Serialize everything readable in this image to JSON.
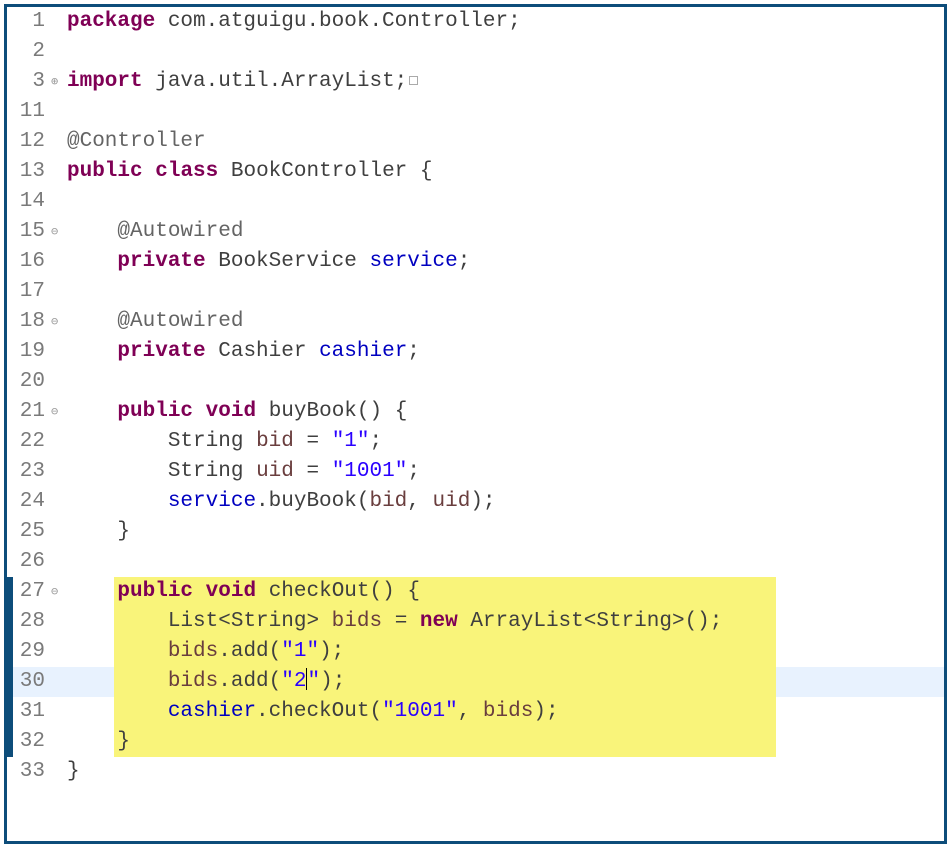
{
  "lines": [
    {
      "num": "1",
      "annot": "",
      "tokens": [
        [
          "kw",
          "package"
        ],
        [
          "txt",
          " com.atguigu.book.Controller;"
        ]
      ]
    },
    {
      "num": "2",
      "annot": "",
      "tokens": []
    },
    {
      "num": "3",
      "annot": "⊕",
      "tokens": [
        [
          "kw",
          "import"
        ],
        [
          "txt",
          " java.util.ArrayList;"
        ]
      ],
      "fold": true
    },
    {
      "num": "11",
      "annot": "",
      "tokens": []
    },
    {
      "num": "12",
      "annot": "",
      "tokens": [
        [
          "annot",
          "@Controller"
        ]
      ]
    },
    {
      "num": "13",
      "annot": "",
      "tokens": [
        [
          "kw",
          "public"
        ],
        [
          "txt",
          " "
        ],
        [
          "kw",
          "class"
        ],
        [
          "txt",
          " "
        ],
        [
          "type",
          "BookController"
        ],
        [
          "txt",
          " {"
        ]
      ]
    },
    {
      "num": "14",
      "annot": "",
      "tokens": []
    },
    {
      "num": "15",
      "annot": "⊖",
      "tokens": [
        [
          "txt",
          "    "
        ],
        [
          "annot",
          "@Autowired"
        ]
      ]
    },
    {
      "num": "16",
      "annot": "",
      "tokens": [
        [
          "txt",
          "    "
        ],
        [
          "kw",
          "private"
        ],
        [
          "txt",
          " "
        ],
        [
          "type",
          "BookService"
        ],
        [
          "txt",
          " "
        ],
        [
          "field",
          "service"
        ],
        [
          "txt",
          ";"
        ]
      ]
    },
    {
      "num": "17",
      "annot": "",
      "tokens": []
    },
    {
      "num": "18",
      "annot": "⊖",
      "tokens": [
        [
          "txt",
          "    "
        ],
        [
          "annot",
          "@Autowired"
        ]
      ]
    },
    {
      "num": "19",
      "annot": "",
      "tokens": [
        [
          "txt",
          "    "
        ],
        [
          "kw",
          "private"
        ],
        [
          "txt",
          " "
        ],
        [
          "type",
          "Cashier"
        ],
        [
          "txt",
          " "
        ],
        [
          "field",
          "cashier"
        ],
        [
          "txt",
          ";"
        ]
      ]
    },
    {
      "num": "20",
      "annot": "",
      "tokens": []
    },
    {
      "num": "21",
      "annot": "⊖",
      "tokens": [
        [
          "txt",
          "    "
        ],
        [
          "kw",
          "public"
        ],
        [
          "txt",
          " "
        ],
        [
          "kw",
          "void"
        ],
        [
          "txt",
          " "
        ],
        [
          "method",
          "buyBook"
        ],
        [
          "txt",
          "() {"
        ]
      ]
    },
    {
      "num": "22",
      "annot": "",
      "tokens": [
        [
          "txt",
          "        "
        ],
        [
          "type",
          "String"
        ],
        [
          "txt",
          " "
        ],
        [
          "var",
          "bid"
        ],
        [
          "txt",
          " = "
        ],
        [
          "str",
          "\"1\""
        ],
        [
          "txt",
          ";"
        ]
      ]
    },
    {
      "num": "23",
      "annot": "",
      "tokens": [
        [
          "txt",
          "        "
        ],
        [
          "type",
          "String"
        ],
        [
          "txt",
          " "
        ],
        [
          "var",
          "uid"
        ],
        [
          "txt",
          " = "
        ],
        [
          "str",
          "\"1001\""
        ],
        [
          "txt",
          ";"
        ]
      ]
    },
    {
      "num": "24",
      "annot": "",
      "tokens": [
        [
          "txt",
          "        "
        ],
        [
          "field",
          "service"
        ],
        [
          "txt",
          ".buyBook("
        ],
        [
          "var",
          "bid"
        ],
        [
          "txt",
          ", "
        ],
        [
          "var",
          "uid"
        ],
        [
          "txt",
          ");"
        ]
      ]
    },
    {
      "num": "25",
      "annot": "",
      "tokens": [
        [
          "txt",
          "    }"
        ]
      ]
    },
    {
      "num": "26",
      "annot": "",
      "tokens": []
    },
    {
      "num": "27",
      "annot": "⊖",
      "hlYellow": true,
      "stripe": true,
      "tokens": [
        [
          "txt",
          "    "
        ],
        [
          "kw",
          "public"
        ],
        [
          "txt",
          " "
        ],
        [
          "kw",
          "void"
        ],
        [
          "txt",
          " "
        ],
        [
          "method",
          "checkOut"
        ],
        [
          "txt",
          "() {"
        ]
      ]
    },
    {
      "num": "28",
      "annot": "",
      "hlYellow": true,
      "stripe": true,
      "tokens": [
        [
          "txt",
          "        "
        ],
        [
          "type",
          "List<String>"
        ],
        [
          "txt",
          " "
        ],
        [
          "var",
          "bids"
        ],
        [
          "txt",
          " = "
        ],
        [
          "kw",
          "new"
        ],
        [
          "txt",
          " "
        ],
        [
          "type",
          "ArrayList<String>"
        ],
        [
          "txt",
          "();"
        ]
      ]
    },
    {
      "num": "29",
      "annot": "",
      "hlYellow": true,
      "stripe": true,
      "tokens": [
        [
          "txt",
          "        "
        ],
        [
          "var",
          "bids"
        ],
        [
          "txt",
          ".add("
        ],
        [
          "str",
          "\"1\""
        ],
        [
          "txt",
          ");"
        ]
      ]
    },
    {
      "num": "30",
      "annot": "",
      "hlBlue": true,
      "hlYellow": true,
      "stripe": true,
      "caretAfter": 4,
      "tokens": [
        [
          "txt",
          "        "
        ],
        [
          "var",
          "bids"
        ],
        [
          "txt",
          ".add("
        ],
        [
          "str",
          "\"2"
        ],
        [
          "str",
          "\""
        ],
        [
          "txt",
          ");"
        ]
      ]
    },
    {
      "num": "31",
      "annot": "",
      "hlYellow": true,
      "stripe": true,
      "tokens": [
        [
          "txt",
          "        "
        ],
        [
          "field",
          "cashier"
        ],
        [
          "txt",
          ".checkOut("
        ],
        [
          "str",
          "\"1001\""
        ],
        [
          "txt",
          ", "
        ],
        [
          "var",
          "bids"
        ],
        [
          "txt",
          ");"
        ]
      ]
    },
    {
      "num": "32",
      "annot": "",
      "hlYellow": true,
      "stripe": true,
      "tokens": [
        [
          "txt",
          "    }"
        ]
      ]
    },
    {
      "num": "33",
      "annot": "",
      "tokens": [
        [
          "txt",
          "}"
        ]
      ]
    }
  ],
  "highlight": {
    "startRow": 19,
    "endRow": 25
  },
  "colors": {
    "keyword": "#7f0055",
    "annotation": "#646464",
    "field": "#0000c0",
    "string": "#2a00ff",
    "localvar": "#6a3e3e",
    "border": "#0d4d7a",
    "yellowHL": "#f9f47a",
    "blueHL": "#e8f2fe"
  }
}
